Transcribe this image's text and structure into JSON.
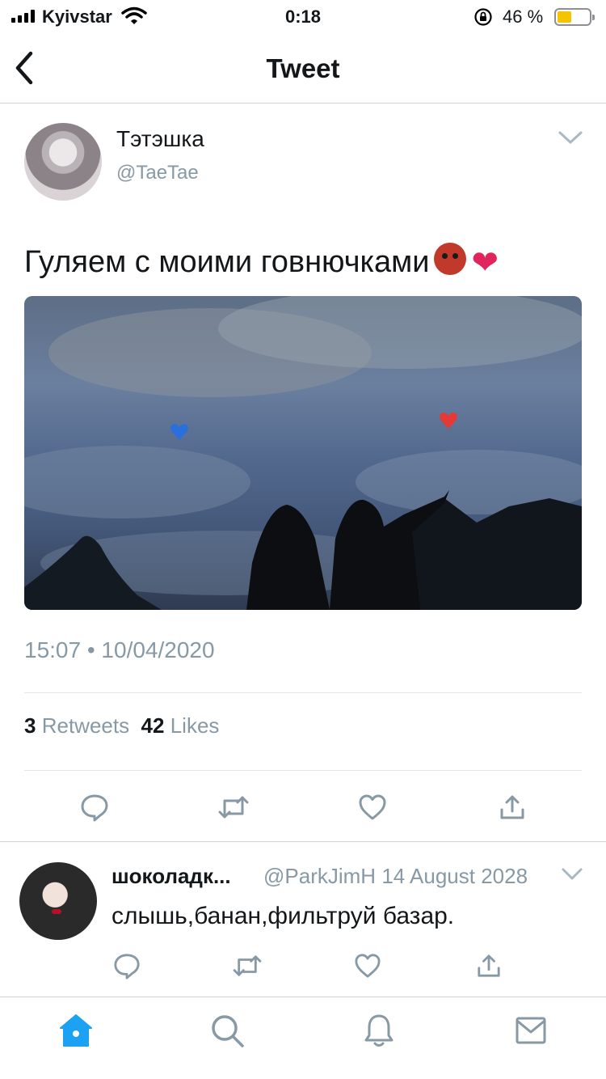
{
  "status_bar": {
    "carrier": "Kyivstar",
    "time": "0:18",
    "battery_percent": "46 %",
    "battery_level": 0.46
  },
  "nav": {
    "title": "Tweet"
  },
  "tweet": {
    "author_name": "Тэтэшка",
    "author_handle": "@TaeTae",
    "text": "Гуляем с моими говнючками",
    "timestamp": "15:07 • 10/04/2020",
    "retweets_count": "3",
    "retweets_label": "Retweets",
    "likes_count": "42",
    "likes_label": "Likes"
  },
  "reply": {
    "author_name": "шоколадк...",
    "author_handle": "@ParkJimH",
    "date": "14 August 2028",
    "text": "слышь,банан,фильтруй базар."
  },
  "colors": {
    "accent": "#1da1f2",
    "icon_gray": "#8899a6",
    "like_red": "#e0245e",
    "battery_yellow": "#f5c400"
  },
  "icons": {
    "back": "chevron-left-icon",
    "caret": "chevron-down-icon",
    "reply": "reply-icon",
    "retweet": "retweet-icon",
    "like": "heart-icon",
    "share": "share-icon",
    "home": "home-icon",
    "search": "search-icon",
    "notifications": "bell-icon",
    "messages": "mail-icon"
  }
}
